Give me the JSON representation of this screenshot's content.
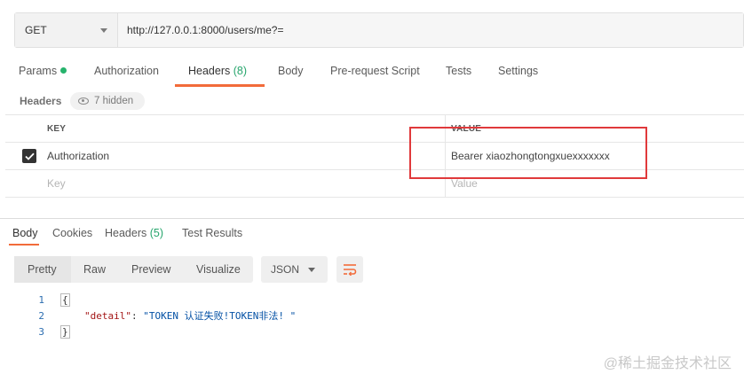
{
  "request": {
    "method": "GET",
    "url": "http://127.0.0.1:8000/users/me?="
  },
  "request_tabs": [
    {
      "label": "Params",
      "dot": true
    },
    {
      "label": "Authorization"
    },
    {
      "label": "Headers",
      "count": "(8)",
      "active": true
    },
    {
      "label": "Body"
    },
    {
      "label": "Pre-request Script"
    },
    {
      "label": "Tests"
    },
    {
      "label": "Settings"
    }
  ],
  "headers_section": {
    "title": "Headers",
    "hidden_label": "7 hidden",
    "columns": {
      "key": "KEY",
      "value": "VALUE"
    },
    "rows": [
      {
        "checked": true,
        "key": "Authorization",
        "value": "Bearer xiaozhongtongxuexxxxxxx"
      }
    ],
    "placeholders": {
      "key": "Key",
      "value": "Value"
    }
  },
  "response_tabs": [
    {
      "label": "Body",
      "active": true
    },
    {
      "label": "Cookies"
    },
    {
      "label": "Headers",
      "count": "(5)"
    },
    {
      "label": "Test Results"
    }
  ],
  "view_modes": [
    "Pretty",
    "Raw",
    "Preview",
    "Visualize"
  ],
  "active_view": "Pretty",
  "format": "JSON",
  "code": {
    "line_numbers": [
      "1",
      "2",
      "3"
    ],
    "open_brace": "{",
    "close_brace": "}",
    "key": "\"detail\"",
    "colon": ": ",
    "value": "\"TOKEN 认证失败!TOKEN非法! \""
  },
  "watermark": "@稀土掘金技术社区",
  "colors": {
    "accent_orange": "#f26b3a",
    "green": "#26a56c",
    "highlight_red": "#e0393b"
  }
}
